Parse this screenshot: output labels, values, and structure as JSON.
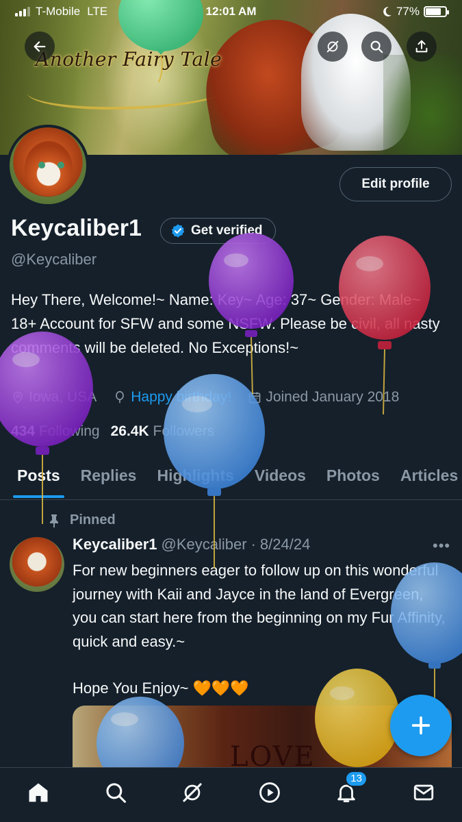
{
  "status_bar": {
    "carrier": "T-Mobile",
    "network": "LTE",
    "time": "12:01 AM",
    "battery": "77%",
    "battery_level": 0.77
  },
  "banner": {
    "title": "Another Fairy Tale"
  },
  "profile": {
    "display_name": "Keycaliber1",
    "verify_label": "Get verified",
    "handle": "@Keycaliber",
    "edit_label": "Edit profile",
    "bio": "Hey There, Welcome!~ Name: Key~ Age: 37~ Gender: Male~ 18+ Account for SFW and some NSFW. Please be civil, all nasty comments will be deleted. No Exceptions!~",
    "location": "Iowa, USA",
    "birthday": "Happy birthday!",
    "joined": "Joined January 2018",
    "following_count": "434",
    "following_label": "Following",
    "followers_count": "26.4K",
    "followers_label": "Followers"
  },
  "tabs": [
    "Posts",
    "Replies",
    "Highlights",
    "Videos",
    "Photos",
    "Articles"
  ],
  "active_tab": "Posts",
  "pinned_post": {
    "pinned_label": "Pinned",
    "author": "Keycaliber1",
    "handle": "@Keycaliber",
    "date": "8/24/24",
    "text": "For new beginners eager to follow up on this wonderful journey with Kaii and Jayce in the land of Evergreen, you can start here from the beginning on my Fur Affinity, quick and easy.~",
    "text2": "Hope You Enjoy~ 🧡🧡🧡",
    "media_text": "LOVE"
  },
  "bottom_nav": {
    "items": [
      "home-icon",
      "search-icon",
      "grok-icon",
      "video-icon",
      "notifications-icon",
      "messages-icon"
    ],
    "notification_badge": "13"
  },
  "colors": {
    "background": "#15202b",
    "accent": "#1d9bf0",
    "muted": "#8b98a5",
    "border": "#536471"
  }
}
